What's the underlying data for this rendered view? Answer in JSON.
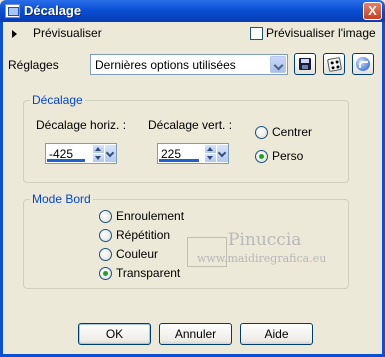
{
  "window": {
    "title": "Décalage",
    "close_label": "X"
  },
  "preview": {
    "expander_label": "Prévisualiser",
    "checkbox_label": "Prévisualiser l'image",
    "checked": false
  },
  "settings": {
    "label": "Réglages",
    "selected_preset": "Dernières options utilisées",
    "buttons": [
      "save-preset-icon",
      "randomize-icon",
      "reset-icon"
    ]
  },
  "offset": {
    "group_title": "Décalage",
    "horiz_label": "Décalage horiz. :",
    "horiz_value": "-425",
    "vert_label": "Décalage vert. :",
    "vert_value": "225",
    "options": [
      {
        "label": "Centrer",
        "selected": false
      },
      {
        "label": "Perso",
        "selected": true
      }
    ]
  },
  "edge_mode": {
    "group_title": "Mode Bord",
    "options": [
      {
        "label": "Enroulement",
        "selected": false
      },
      {
        "label": "Répétition",
        "selected": false
      },
      {
        "label": "Couleur",
        "selected": false
      },
      {
        "label": "Transparent",
        "selected": true
      }
    ]
  },
  "watermark": {
    "name": "Pinuccia",
    "url": "www.maidiregrafica.eu"
  },
  "footer": {
    "ok_label": "OK",
    "cancel_label": "Annuler",
    "help_label": "Aide"
  },
  "colors": {
    "title_bar": "#0a4fd4",
    "group_title": "#0046d5",
    "dialog_bg": "#ece9d8",
    "radio_dot": "#21a121"
  }
}
